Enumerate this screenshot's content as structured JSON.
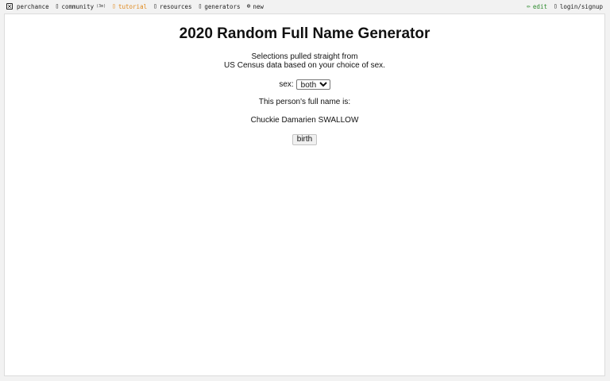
{
  "nav": {
    "brand": "perchance",
    "community": "community",
    "community_badge": "(3m)",
    "tutorial": "tutorial",
    "resources": "resources",
    "generators": "generators",
    "new": "new",
    "edit": "edit",
    "login": "login/signup"
  },
  "page": {
    "title": "2020 Random Full Name Generator",
    "desc_line1": "Selections pulled straight from",
    "desc_line2": "US Census data based on your choice of sex.",
    "sex_label": "sex:",
    "sex_selected": "both",
    "result_label": "This person's full name is:",
    "result_name": "Chuckie Damarien SWALLOW",
    "birth_button": "birth"
  },
  "colors": {
    "tutorial": "#e08a1e",
    "edit": "#2e8b2e"
  }
}
